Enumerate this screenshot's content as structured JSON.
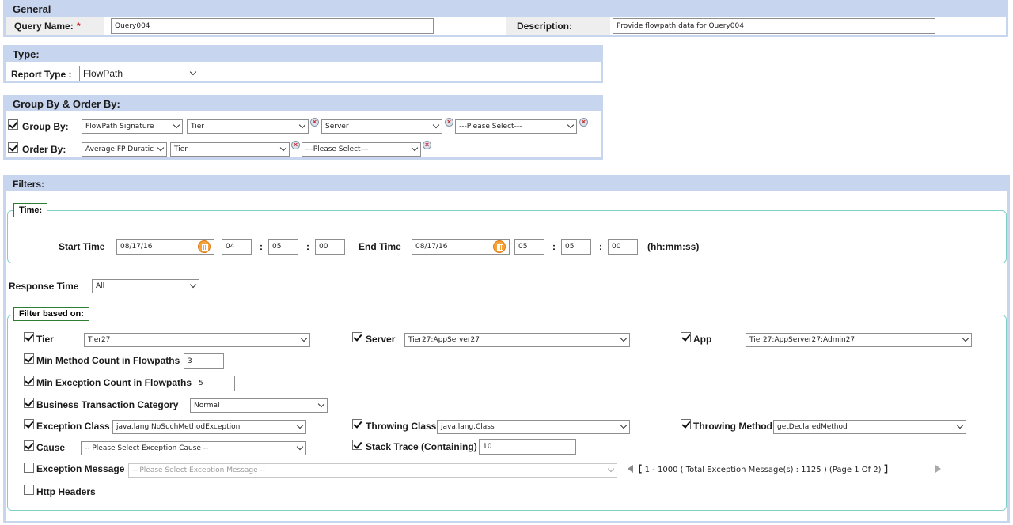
{
  "general": {
    "title": "General",
    "query_name_label": "Query Name:",
    "required_mark": "*",
    "query_name_value": "Query004",
    "description_label": "Description:",
    "description_value": "Provide flowpath data for Query004"
  },
  "type": {
    "title": "Type:",
    "report_type_label": "Report Type :",
    "report_type_value": "FlowPath"
  },
  "group_order": {
    "title": "Group By & Order By:",
    "group_by_label": "Group By:",
    "group_by_checked": true,
    "group_by": [
      "FlowPath Signature",
      "Tier",
      "Server",
      "---Please Select---"
    ],
    "order_by_label": "Order By:",
    "order_by_checked": true,
    "order_by": [
      "Average FP Duratic",
      "Tier",
      "---Please Select---"
    ],
    "remove_glyph": "×"
  },
  "filters": {
    "title": "Filters:",
    "time": {
      "legend": "Time:",
      "start_label": "Start Time",
      "start_date": "08/17/16",
      "start_hh": "04",
      "start_mm": "05",
      "start_ss": "00",
      "end_label": "End Time",
      "end_date": "08/17/16",
      "end_hh": "05",
      "end_mm": "05",
      "end_ss": "00",
      "sep": ":",
      "format_hint": "(hh:mm:ss)"
    },
    "response_time_label": "Response Time",
    "response_time_value": "All",
    "filter_based_on": {
      "legend": "Filter based on:",
      "tier_label": "Tier",
      "tier_value": "Tier27",
      "server_label": "Server",
      "server_value": "Tier27:AppServer27",
      "app_label": "App",
      "app_value": "Tier27:AppServer27:Admin27",
      "min_method_label": "Min Method Count in Flowpaths",
      "min_method_value": "3",
      "min_exception_label": "Min Exception Count in Flowpaths",
      "min_exception_value": "5",
      "btc_label": "Business Transaction Category",
      "btc_value": "Normal",
      "exception_class_label": "Exception Class",
      "exception_class_value": "java.lang.NoSuchMethodException",
      "throwing_class_label": "Throwing Class",
      "throwing_class_value": "java.lang.Class",
      "throwing_method_label": "Throwing Method",
      "throwing_method_value": "getDeclaredMethod",
      "cause_label": "Cause",
      "cause_value": "-- Please Select Exception Cause --",
      "stack_trace_label": "Stack Trace (Containing)",
      "stack_trace_value": "10",
      "exception_message_label": "Exception Message",
      "exception_message_value": "-- Please Select Exception Message --",
      "pager_open": "[",
      "pager_text": "1 - 1000 ( Total Exception Message(s) : 1125 ) (Page 1 Of 2)",
      "pager_close": "]",
      "http_headers_label": "Http Headers"
    }
  }
}
